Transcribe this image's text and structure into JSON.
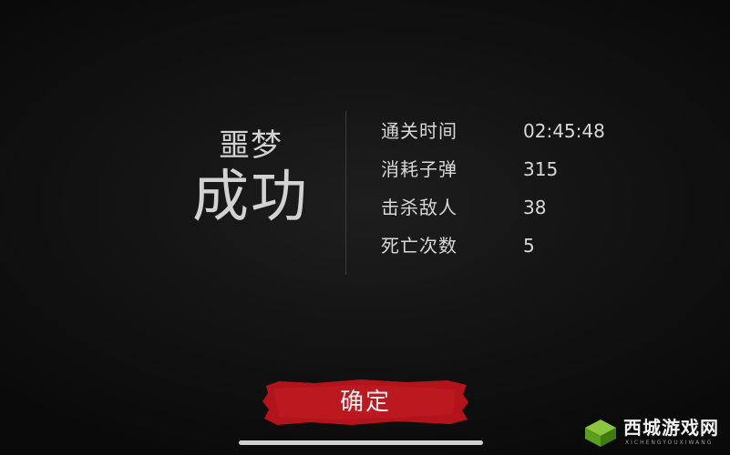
{
  "result_panel": {
    "difficulty": "噩梦",
    "result": "成功"
  },
  "stats": [
    {
      "label": "通关时间",
      "value": "02:45:48"
    },
    {
      "label": "消耗子弹",
      "value": "315"
    },
    {
      "label": "击杀敌人",
      "value": "38"
    },
    {
      "label": "死亡次数",
      "value": "5"
    }
  ],
  "confirm_button": {
    "label": "确定",
    "color": "#b3141c"
  },
  "watermark": {
    "title": "西城游戏网",
    "subtitle": "XICHENGYOUXIWANG"
  }
}
